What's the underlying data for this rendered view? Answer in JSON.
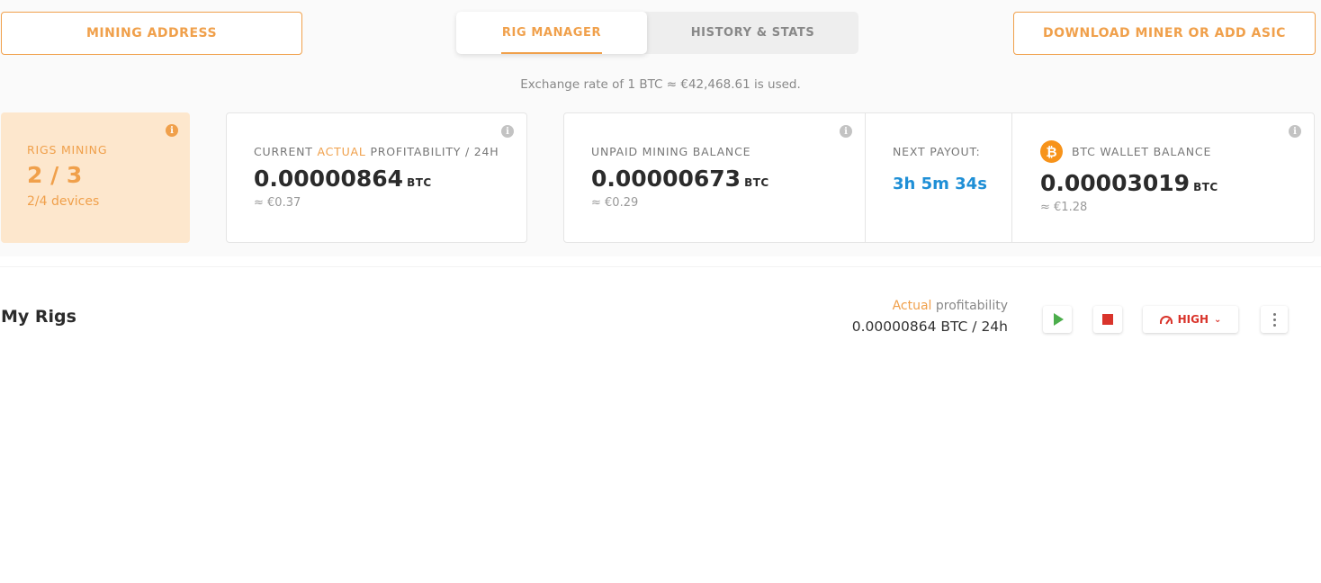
{
  "header": {
    "mining_address_label": "MINING ADDRESS",
    "download_label": "DOWNLOAD MINER OR ADD ASIC",
    "tabs": [
      {
        "label": "RIG MANAGER",
        "active": true
      },
      {
        "label": "HISTORY & STATS",
        "active": false
      }
    ],
    "exchange_rate_text": "Exchange rate of 1 BTC ≈ €42,468.61 is used."
  },
  "cards": {
    "rigs_mining": {
      "label": "RIGS MINING",
      "count": "2 / 3",
      "devices": "2/4 devices"
    },
    "profitability": {
      "label_prefix": "CURRENT ",
      "label_accent": "ACTUAL",
      "label_suffix": " PROFITABILITY / 24H",
      "value": "0.00000864",
      "unit": "BTC",
      "fiat": "≈ €0.37"
    },
    "unpaid_balance": {
      "label": "UNPAID MINING BALANCE",
      "value": "0.00000673",
      "unit": "BTC",
      "fiat": "≈ €0.29"
    },
    "next_payout": {
      "label": "NEXT PAYOUT:",
      "time": "3h 5m 34s"
    },
    "wallet_balance": {
      "label": "BTC WALLET BALANCE",
      "value": "0.00003019",
      "unit": "BTC",
      "fiat": "≈ €1.28"
    }
  },
  "my_rigs": {
    "title": "My Rigs",
    "profit_caption_accent": "Actual",
    "profit_caption_rest": " profitability",
    "profit_value": "0.00000864 BTC / 24h",
    "mode_label": "HIGH"
  },
  "icons": {
    "info": "i",
    "btc": "₿",
    "chevron": "⌄"
  },
  "colors": {
    "accent": "#f0a04b",
    "rigs_card_bg": "#fde7cd",
    "payout_blue": "#1f8fd6",
    "play_green": "#4cae4c",
    "stop_red": "#d9342b",
    "btc_orange": "#f7931a"
  }
}
